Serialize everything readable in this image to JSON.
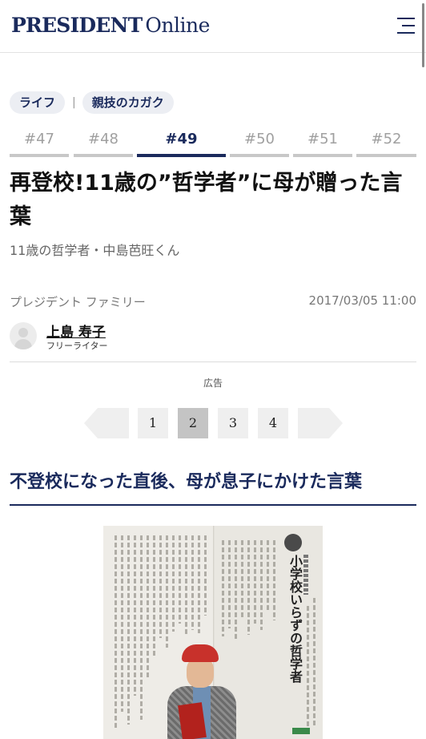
{
  "header": {
    "logo_bold": "PRESIDENT",
    "logo_rest": "Online",
    "menu_icon": "hamburger-menu-icon"
  },
  "tags": {
    "category": "ライフ",
    "separator": "|",
    "series": "親技のカガク"
  },
  "series_tabs": [
    {
      "label": "#47",
      "active": false
    },
    {
      "label": "#48",
      "active": false
    },
    {
      "label": "#49",
      "active": true
    },
    {
      "label": "#50",
      "active": false
    },
    {
      "label": "#51",
      "active": false
    },
    {
      "label": "#52",
      "active": false
    }
  ],
  "article": {
    "title": "再登校!11歳の”哲学者”に母が贈った言葉",
    "subtitle": "11歳の哲学者・中島芭旺くん",
    "publisher": "プレジデント ファミリー",
    "date": "2017/03/05 11:00",
    "author_name": "上島 寿子",
    "author_role": "フリーライター",
    "ad_label": "広告",
    "section_heading": "不登校になった直後、母が息子にかけた言葉"
  },
  "pagination": {
    "pages": [
      "1",
      "2",
      "3",
      "4"
    ],
    "current": "2"
  },
  "photo": {
    "magazine_heading": "小学校いらずの哲学者"
  },
  "colors": {
    "brand_navy": "#1a2a5c",
    "tab_inactive": "#c8c8c8",
    "tag_bg": "#eceef3",
    "pager_bg": "#efefef",
    "pager_current": "#c4c4c4"
  }
}
